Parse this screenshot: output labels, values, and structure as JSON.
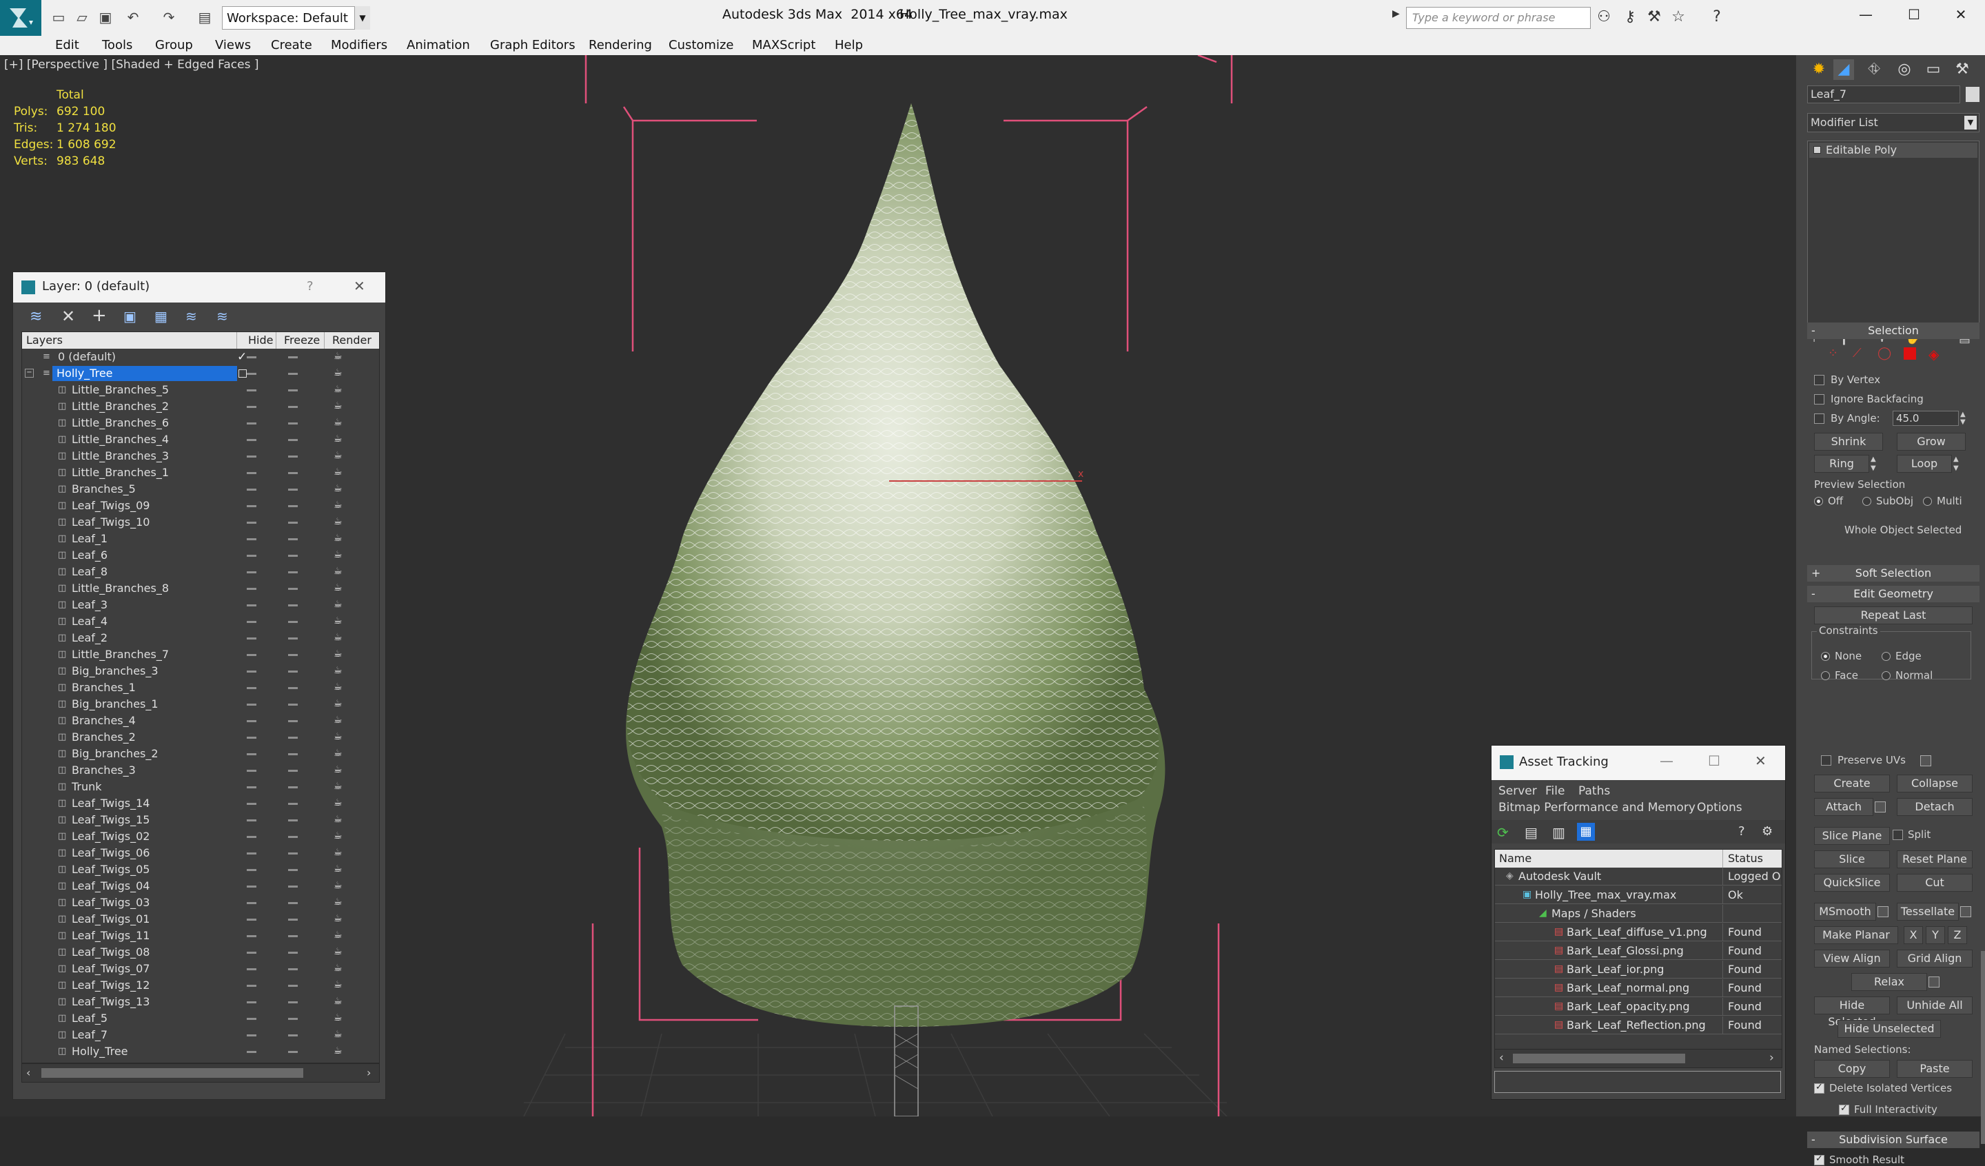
{
  "titlebar": {
    "workspace": "Workspace: Default",
    "app_title": "Autodesk 3ds Max  2014 x64",
    "file_title": "Holly_Tree_max_vray.max",
    "search_placeholder": "Type a keyword or phrase"
  },
  "menu": [
    "Edit",
    "Tools",
    "Group",
    "Views",
    "Create",
    "Modifiers",
    "Animation",
    "Graph Editors",
    "Rendering",
    "Customize",
    "MAXScript",
    "Help"
  ],
  "viewport": {
    "label": "[+] [Perspective ] [Shaded + Edged Faces ]",
    "stats_header": "Total",
    "stats": [
      {
        "label": "Polys:",
        "value": "692 100"
      },
      {
        "label": "Tris:",
        "value": "1 274 180"
      },
      {
        "label": "Edges:",
        "value": "1 608 692"
      },
      {
        "label": "Verts:",
        "value": "983 648"
      }
    ]
  },
  "layer_dialog": {
    "title": "Layer: 0 (default)",
    "help": "?",
    "columns": [
      "Layers",
      "Hide",
      "Freeze",
      "Render"
    ],
    "layers": [
      {
        "name": "0 (default)"
      },
      {
        "name": "Holly_Tree"
      }
    ],
    "objects": [
      "Little_Branches_5",
      "Little_Branches_2",
      "Little_Branches_6",
      "Little_Branches_4",
      "Little_Branches_3",
      "Little_Branches_1",
      "Branches_5",
      "Leaf_Twigs_09",
      "Leaf_Twigs_10",
      "Leaf_1",
      "Leaf_6",
      "Leaf_8",
      "Little_Branches_8",
      "Leaf_3",
      "Leaf_4",
      "Leaf_2",
      "Little_Branches_7",
      "Big_branches_3",
      "Branches_1",
      "Big_branches_1",
      "Branches_4",
      "Branches_2",
      "Big_branches_2",
      "Branches_3",
      "Trunk",
      "Leaf_Twigs_14",
      "Leaf_Twigs_15",
      "Leaf_Twigs_02",
      "Leaf_Twigs_06",
      "Leaf_Twigs_05",
      "Leaf_Twigs_04",
      "Leaf_Twigs_03",
      "Leaf_Twigs_01",
      "Leaf_Twigs_11",
      "Leaf_Twigs_08",
      "Leaf_Twigs_07",
      "Leaf_Twigs_12",
      "Leaf_Twigs_13",
      "Leaf_5",
      "Leaf_7",
      "Holly_Tree"
    ]
  },
  "asset_dialog": {
    "title": "Asset Tracking",
    "menu": [
      "Server",
      "File",
      "Paths"
    ],
    "menu2": [
      "Bitmap Performance and Memory",
      "Options"
    ],
    "columns": [
      "Name",
      "Status"
    ],
    "rows": [
      {
        "name": "Autodesk Vault",
        "status": "Logged O"
      },
      {
        "name": "Holly_Tree_max_vray.max",
        "status": "Ok"
      },
      {
        "name": "Maps / Shaders",
        "status": ""
      },
      {
        "name": "Bark_Leaf_diffuse_v1.png",
        "status": "Found"
      },
      {
        "name": "Bark_Leaf_Glossi.png",
        "status": "Found"
      },
      {
        "name": "Bark_Leaf_ior.png",
        "status": "Found"
      },
      {
        "name": "Bark_Leaf_normal.png",
        "status": "Found"
      },
      {
        "name": "Bark_Leaf_opacity.png",
        "status": "Found"
      },
      {
        "name": "Bark_Leaf_Reflection.png",
        "status": "Found"
      }
    ]
  },
  "command_panel": {
    "object_name": "Leaf_7",
    "modifier_list": "Modifier List",
    "stack_item": "Editable Poly",
    "selection": {
      "header": "Selection",
      "by_vertex": "By Vertex",
      "ignore_backfacing": "Ignore Backfacing",
      "by_angle": "By Angle:",
      "angle_value": "45.0",
      "shrink": "Shrink",
      "grow": "Grow",
      "ring": "Ring",
      "loop": "Loop",
      "preview_selection": "Preview Selection",
      "off": "Off",
      "subobj": "SubObj",
      "multi": "Multi",
      "whole_object": "Whole Object Selected"
    },
    "soft_selection": "Soft Selection",
    "edit_geometry": {
      "header": "Edit Geometry",
      "repeat_last": "Repeat Last",
      "constraints": "Constraints",
      "none": "None",
      "edge": "Edge",
      "face": "Face",
      "normal": "Normal",
      "preserve_uvs": "Preserve UVs",
      "create": "Create",
      "collapse": "Collapse",
      "attach": "Attach",
      "detach": "Detach",
      "slice_plane": "Slice Plane",
      "split": "Split",
      "slice": "Slice",
      "reset_plane": "Reset Plane",
      "quickslice": "QuickSlice",
      "cut": "Cut",
      "msmooth": "MSmooth",
      "tessellate": "Tessellate",
      "make_planar": "Make Planar",
      "x": "X",
      "y": "Y",
      "z": "Z",
      "view_align": "View Align",
      "grid_align": "Grid Align",
      "relax": "Relax",
      "hide_selected": "Hide Selected",
      "unhide_all": "Unhide All",
      "hide_unselected": "Hide Unselected",
      "named_selections": "Named Selections:",
      "copy": "Copy",
      "paste": "Paste",
      "delete_isolated": "Delete Isolated Vertices",
      "full_interactivity": "Full Interactivity"
    },
    "subdivision_surface": "Subdivision Surface",
    "smooth_result": "Smooth Result"
  },
  "colors": {
    "viewport_bg": "#2f2f2f",
    "stats_yellow": "#f0e040",
    "selection_blue": "#1e6fd9",
    "bbox_pink": "#e0507a",
    "leaf_green": "#7e9a5a"
  }
}
